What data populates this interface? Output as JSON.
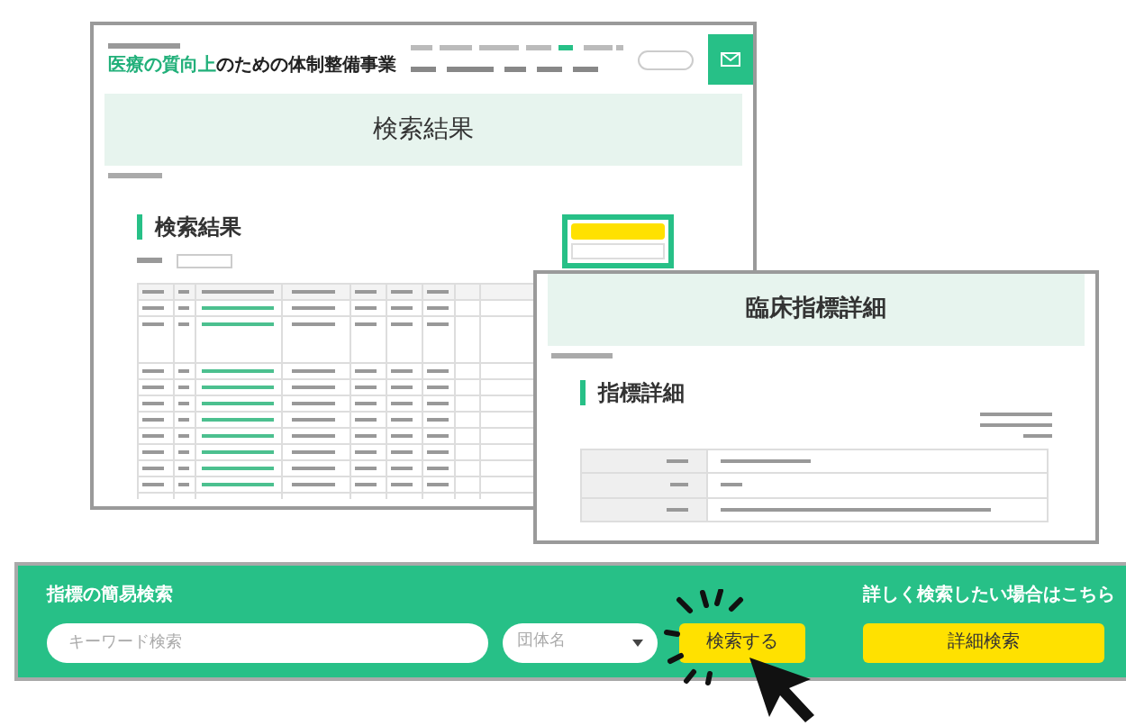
{
  "results_window": {
    "logo": {
      "highlight": "医療の質向上",
      "rest": "のための体制整備事業"
    },
    "hero_title": "検索結果",
    "section_heading": "検索結果"
  },
  "detail_window": {
    "hero_title": "臨床指標詳細",
    "section_heading": "指標詳細"
  },
  "search_bar": {
    "title": "指標の簡易検索",
    "keyword_placeholder": "キーワード検索",
    "group_placeholder": "団体名",
    "search_button": "検索する",
    "advanced_title": "詳しく検索したい場合はこちら",
    "advanced_button": "詳細検索"
  }
}
